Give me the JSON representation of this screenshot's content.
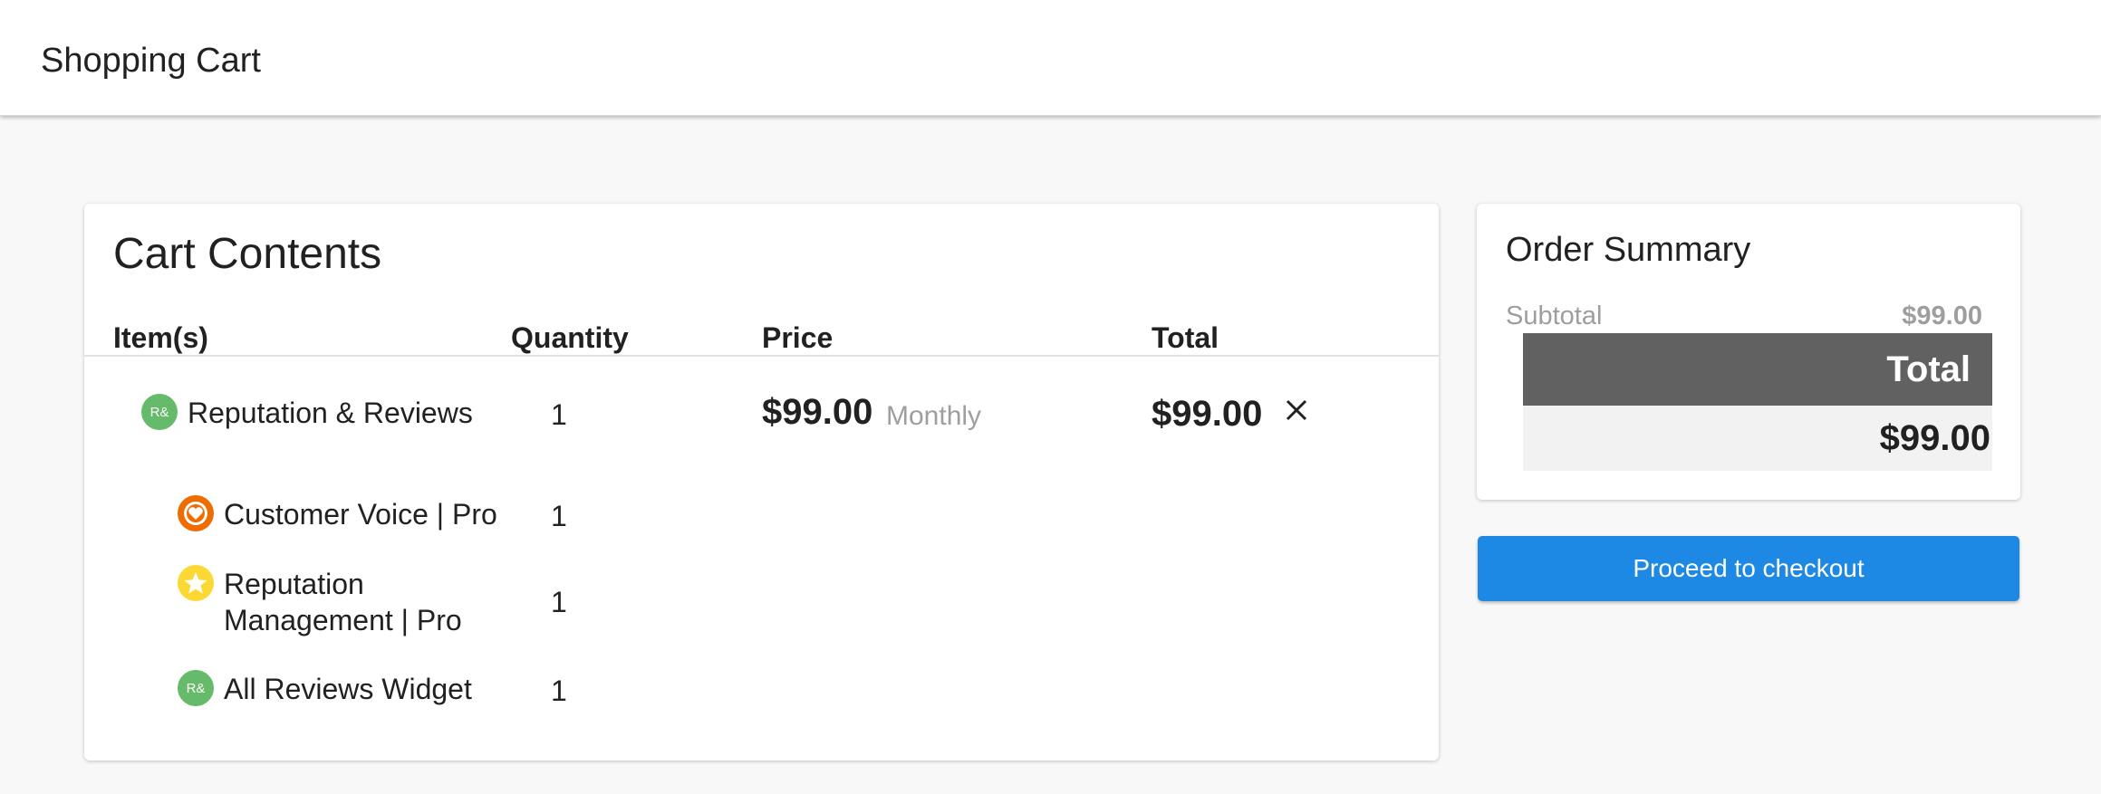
{
  "header": {
    "title": "Shopping Cart"
  },
  "cart": {
    "title": "Cart Contents",
    "columns": {
      "items": "Item(s)",
      "quantity": "Quantity",
      "price": "Price",
      "total": "Total"
    },
    "main_item": {
      "name": "Reputation & Reviews",
      "icon_text": "R&",
      "quantity": "1",
      "price": "$99.00",
      "period": "Monthly",
      "total": "$99.00",
      "remove_icon": "close-icon"
    },
    "sub_items": [
      {
        "name": "Customer Voice | Pro",
        "quantity": "1",
        "icon": "heart-icon"
      },
      {
        "name_line1": "Reputation",
        "name_line2": "Management | Pro",
        "quantity": "1",
        "icon": "star-icon"
      },
      {
        "name": "All Reviews Widget",
        "quantity": "1",
        "icon_text": "R&"
      }
    ]
  },
  "summary": {
    "title": "Order Summary",
    "subtotal_label": "Subtotal",
    "subtotal_value": "$99.00",
    "total_label": "Total",
    "total_value": "$99.00"
  },
  "checkout": {
    "label": "Proceed to checkout"
  },
  "colors": {
    "accent_blue": "#1e88e5",
    "green_badge": "#66bb6a",
    "orange_badge": "#ef6c00",
    "yellow_badge": "#fdd835",
    "total_bar": "#616161"
  }
}
